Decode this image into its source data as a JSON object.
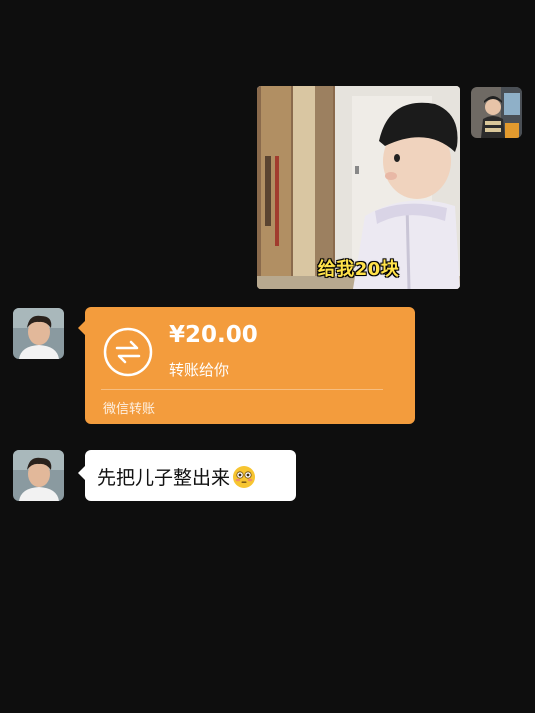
{
  "messages": {
    "photo": {
      "caption": "给我20块"
    },
    "transfer": {
      "amount": "¥20.00",
      "note": "转账给你",
      "footer": "微信转账",
      "color": "#f39c3d"
    },
    "text": {
      "content": "先把儿子整出来",
      "emoji": "flushed-face-icon"
    }
  },
  "theme": {
    "background": "#0e0e0e",
    "bubble_white": "#ffffff"
  }
}
